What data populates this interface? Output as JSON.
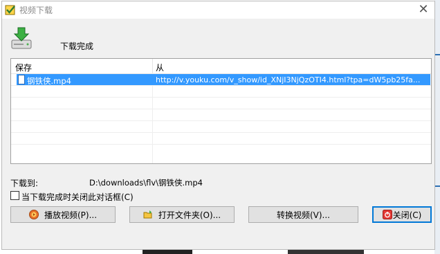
{
  "window": {
    "title": "视频下载",
    "close_glyph": "✕"
  },
  "status": {
    "text": "下载完成"
  },
  "list": {
    "columns": [
      "保存",
      "从"
    ],
    "rows": [
      {
        "name": "钢铁侠.mp4",
        "url": "http://v.youku.com/v_show/id_XNjI3NjQzOTI4.html?tpa=dW5pb25fa..."
      }
    ]
  },
  "download": {
    "label": "下载到:",
    "path": "D:\\downloads\\flv\\钢铁侠.mp4"
  },
  "options": {
    "close_on_complete_label": "当下载完成时关闭此对话框(C)",
    "close_on_complete_checked": false
  },
  "buttons": {
    "play": "播放视频(P)...",
    "open_folder": "打开文件夹(O)...",
    "convert": "转换视频(V)...",
    "close": "关闭(C)"
  },
  "colors": {
    "selection": "#3399ff",
    "dialog_bg": "#f0f0f0",
    "focus_border": "#0078d7"
  }
}
